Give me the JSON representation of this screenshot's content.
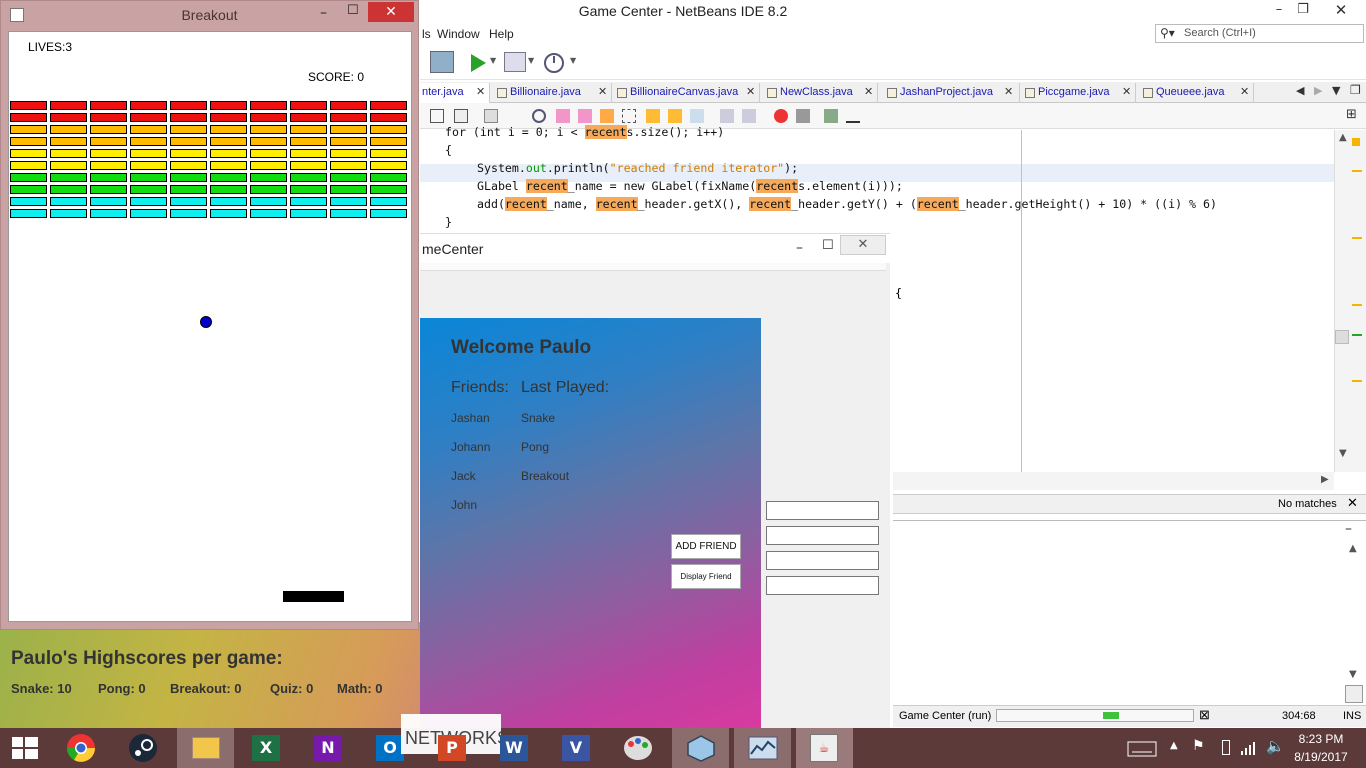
{
  "netbeans": {
    "title": "Game Center - NetBeans IDE 8.2",
    "menu": [
      "ls",
      "Window",
      "Help"
    ],
    "search_placeholder": "Search (Ctrl+I)",
    "tabs": [
      {
        "label": "nter.java"
      },
      {
        "label": "Billionaire.java"
      },
      {
        "label": "BillionaireCanvas.java"
      },
      {
        "label": "NewClass.java"
      },
      {
        "label": "JashanProject.java"
      },
      {
        "label": "Piccgame.java"
      },
      {
        "label": "Queueee.java"
      }
    ],
    "code": {
      "line0": "for (int i = 0; i < recents.size(); i++)",
      "line1": "{",
      "line2a": "System.",
      "line2b": "out",
      "line2c": ".println(",
      "line2d": "\"reached friend iterator\"",
      "line2e": ");",
      "line3": "GLabel recent_name = new GLabel(fixName(recents.element(i)));",
      "line4": "add(recent_name, recent_header.getX(), recent_header.getY() + (recent_header.getHeight() + 10) * ((i) % 6)",
      "line5": "}",
      "line6": "{"
    },
    "find_result": "No matches",
    "status": {
      "run_label": "Game Center (run)",
      "position": "304:68",
      "mode": "INS"
    }
  },
  "game_center": {
    "title": "meCenter",
    "welcome": "Welcome Paulo",
    "friends_header": "Friends:",
    "last_played_header": "Last Played:",
    "friends": [
      {
        "name": "Jashan",
        "game": "Snake"
      },
      {
        "name": "Johann",
        "game": "Pong"
      },
      {
        "name": "Jack",
        "game": "Breakout"
      },
      {
        "name": "John",
        "game": ""
      }
    ],
    "add_friend_label": "ADD FRIEND",
    "display_friend_label": "Display Friend",
    "highscores_title": "Paulo's Highscores per game:",
    "highscores": [
      {
        "text": "Snake: 10"
      },
      {
        "text": "Pong: 0"
      },
      {
        "text": "Breakout: 0"
      },
      {
        "text": "Quiz: 0"
      },
      {
        "text": "Math: 0"
      }
    ]
  },
  "breakout": {
    "title": "Breakout",
    "lives": "LIVES:3",
    "score": "SCORE: 0",
    "brick_row_colors": [
      "#ee1111",
      "#ee1111",
      "#ffbb00",
      "#ffbb00",
      "#ffee00",
      "#ffee00",
      "#11dd11",
      "#11dd11",
      "#11eeee",
      "#11eeee"
    ],
    "ball_color": "#0000cc"
  },
  "taskbar": {
    "apps": [
      "start",
      "chrome",
      "steam",
      "file-explorer",
      "excel",
      "onenote",
      "outlook",
      "powerpoint",
      "word",
      "visio",
      "paint",
      "virtualbox",
      "resource-monitor",
      "java"
    ],
    "networks_label": "NETWORKS",
    "time": "8:23 PM",
    "date": "8/19/2017"
  }
}
